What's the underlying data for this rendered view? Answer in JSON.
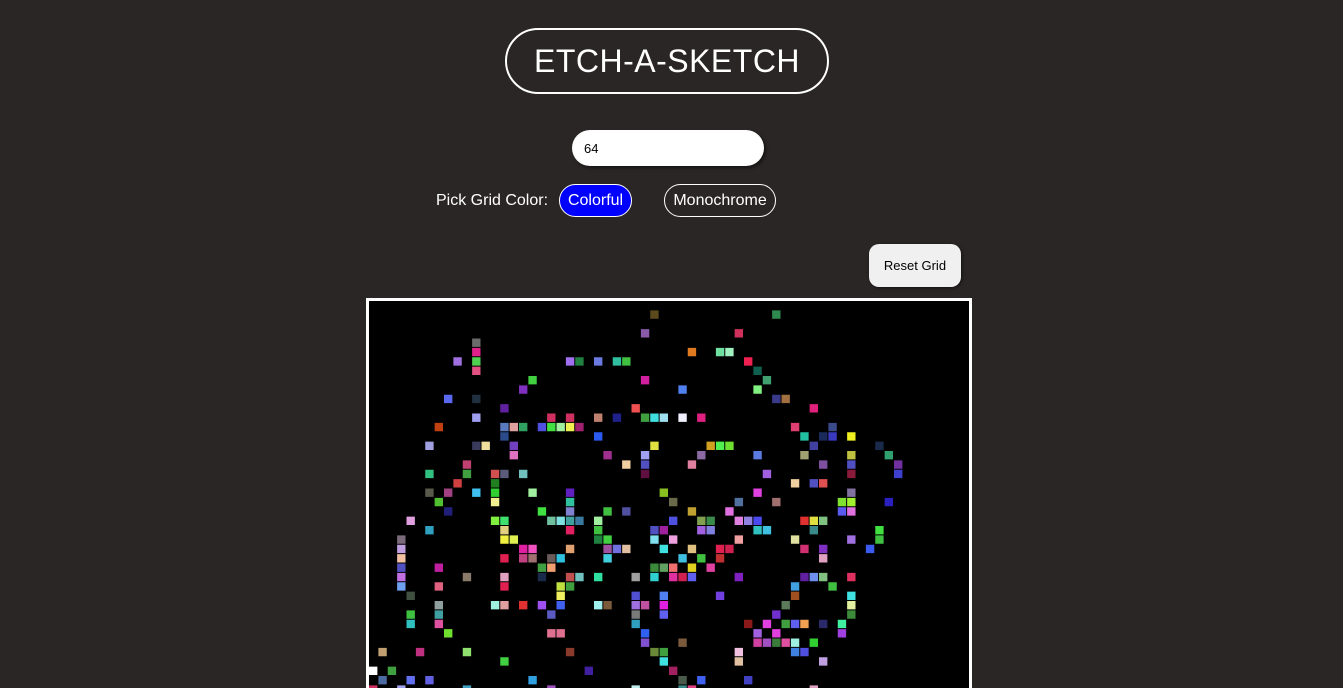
{
  "app": {
    "title": "ETCH-A-SKETCH"
  },
  "controls": {
    "grid_size_value": "64",
    "pick_color_label": "Pick Grid Color:",
    "colorful_label": "Colorful",
    "monochrome_label": "Monochrome",
    "reset_label": "Reset Grid",
    "selected_mode": "Colorful"
  },
  "colors": {
    "background": "#2b2626",
    "grid_background": "#000000",
    "active_button": "#0000ff",
    "frame": "#ffffff"
  },
  "grid": {
    "size": 64,
    "painted_cells": [
      [
        30,
        1,
        "#5b4a1c"
      ],
      [
        43,
        1,
        "#2f8a4f"
      ],
      [
        29,
        3,
        "#8a5aa8"
      ],
      [
        39,
        3,
        "#d0305a"
      ],
      [
        11,
        4,
        "#6a6a6a"
      ],
      [
        11,
        5,
        "#e0208a"
      ],
      [
        34,
        5,
        "#e07a20"
      ],
      [
        37,
        5,
        "#70e0a0"
      ],
      [
        38,
        5,
        "#a0f0c0"
      ],
      [
        9,
        6,
        "#a070e0"
      ],
      [
        11,
        6,
        "#50d050"
      ],
      [
        21,
        6,
        "#a070f0"
      ],
      [
        22,
        6,
        "#208040"
      ],
      [
        24,
        6,
        "#6a7ae0"
      ],
      [
        26,
        6,
        "#30c0a0"
      ],
      [
        27,
        6,
        "#40c040"
      ],
      [
        40,
        6,
        "#f02050"
      ],
      [
        11,
        7,
        "#e05080"
      ],
      [
        41,
        7,
        "#106050"
      ],
      [
        17,
        8,
        "#40d040"
      ],
      [
        29,
        8,
        "#d020a0"
      ],
      [
        42,
        8,
        "#40a070"
      ],
      [
        16,
        9,
        "#8030c0"
      ],
      [
        33,
        9,
        "#5080f0"
      ],
      [
        41,
        9,
        "#80f080"
      ],
      [
        8,
        10,
        "#5a6af0"
      ],
      [
        11,
        10,
        "#203040"
      ],
      [
        43,
        10,
        "#3a3a8a"
      ],
      [
        44,
        10,
        "#a07040"
      ],
      [
        14,
        11,
        "#6020a0"
      ],
      [
        28,
        11,
        "#f05050"
      ],
      [
        47,
        11,
        "#e0207a"
      ],
      [
        11,
        12,
        "#a0a0f0"
      ],
      [
        19,
        12,
        "#d03060"
      ],
      [
        21,
        12,
        "#d03060"
      ],
      [
        24,
        12,
        "#c08070"
      ],
      [
        26,
        12,
        "#20208a"
      ],
      [
        29,
        12,
        "#40a040"
      ],
      [
        30,
        12,
        "#40e0e0"
      ],
      [
        31,
        12,
        "#a0e0f0"
      ],
      [
        33,
        12,
        "#f0f0ff"
      ],
      [
        35,
        12,
        "#e02080"
      ],
      [
        7,
        13,
        "#c04010"
      ],
      [
        14,
        13,
        "#5a7ac0"
      ],
      [
        15,
        13,
        "#e0a0a0"
      ],
      [
        16,
        13,
        "#30a060"
      ],
      [
        18,
        13,
        "#5050e0"
      ],
      [
        19,
        13,
        "#40e040"
      ],
      [
        20,
        13,
        "#a0f0a0"
      ],
      [
        21,
        13,
        "#f0f050"
      ],
      [
        22,
        13,
        "#a02070"
      ],
      [
        45,
        13,
        "#e04070"
      ],
      [
        49,
        13,
        "#3a4a8a"
      ],
      [
        14,
        14,
        "#2a4a8a"
      ],
      [
        24,
        14,
        "#2a5af0"
      ],
      [
        46,
        14,
        "#20c0a0"
      ],
      [
        48,
        14,
        "#1a2a5a"
      ],
      [
        49,
        14,
        "#3a3ac0"
      ],
      [
        51,
        14,
        "#f0f020"
      ],
      [
        6,
        15,
        "#a0a0e0"
      ],
      [
        11,
        15,
        "#3a3a5a"
      ],
      [
        12,
        15,
        "#f0e0a0"
      ],
      [
        15,
        15,
        "#7040c0"
      ],
      [
        30,
        15,
        "#e0e040"
      ],
      [
        36,
        15,
        "#d0a020"
      ],
      [
        37,
        15,
        "#50f050"
      ],
      [
        38,
        15,
        "#70e030"
      ],
      [
        47,
        15,
        "#4040a0"
      ],
      [
        54,
        15,
        "#1a2a4a"
      ],
      [
        15,
        16,
        "#e070c0"
      ],
      [
        25,
        16,
        "#a03090"
      ],
      [
        29,
        16,
        "#a0a0f0"
      ],
      [
        35,
        16,
        "#8a6aa0"
      ],
      [
        41,
        16,
        "#5a7ae0"
      ],
      [
        46,
        16,
        "#a0a070"
      ],
      [
        51,
        16,
        "#c0c040"
      ],
      [
        55,
        16,
        "#30a070"
      ],
      [
        10,
        17,
        "#c04070"
      ],
      [
        27,
        17,
        "#f0d0a0"
      ],
      [
        29,
        17,
        "#5050c0"
      ],
      [
        34,
        17,
        "#e080a0"
      ],
      [
        48,
        17,
        "#8050a0"
      ],
      [
        51,
        17,
        "#5050c0"
      ],
      [
        56,
        17,
        "#7030a0"
      ],
      [
        6,
        18,
        "#30c080"
      ],
      [
        10,
        18,
        "#40a040"
      ],
      [
        13,
        18,
        "#d05050"
      ],
      [
        14,
        18,
        "#5a5a7a"
      ],
      [
        16,
        18,
        "#70c0c0"
      ],
      [
        29,
        18,
        "#601040"
      ],
      [
        42,
        18,
        "#a060e0"
      ],
      [
        51,
        18,
        "#8a1a3a"
      ],
      [
        56,
        18,
        "#4040d0"
      ],
      [
        9,
        19,
        "#d04040"
      ],
      [
        13,
        19,
        "#208020"
      ],
      [
        45,
        19,
        "#f0d0a0"
      ],
      [
        47,
        19,
        "#5050c0"
      ],
      [
        48,
        19,
        "#e05050"
      ],
      [
        6,
        20,
        "#5a5a4a"
      ],
      [
        8,
        20,
        "#a04080"
      ],
      [
        11,
        20,
        "#40c0f0"
      ],
      [
        13,
        20,
        "#30d030"
      ],
      [
        17,
        20,
        "#a0f0a0"
      ],
      [
        21,
        20,
        "#6020c0"
      ],
      [
        31,
        20,
        "#8ac020"
      ],
      [
        41,
        20,
        "#e040e0"
      ],
      [
        51,
        20,
        "#8070a0"
      ],
      [
        7,
        21,
        "#50c030"
      ],
      [
        13,
        21,
        "#f0f090"
      ],
      [
        21,
        21,
        "#30c0a0"
      ],
      [
        32,
        21,
        "#6a6a4a"
      ],
      [
        39,
        21,
        "#5070a0"
      ],
      [
        43,
        21,
        "#a07070"
      ],
      [
        50,
        21,
        "#80e030"
      ],
      [
        51,
        21,
        "#a0f030"
      ],
      [
        55,
        21,
        "#2a20c0"
      ],
      [
        8,
        22,
        "#20207a"
      ],
      [
        18,
        22,
        "#40e040"
      ],
      [
        21,
        22,
        "#8080d0"
      ],
      [
        25,
        22,
        "#40c040"
      ],
      [
        27,
        22,
        "#5050a0"
      ],
      [
        34,
        22,
        "#c0a030"
      ],
      [
        38,
        22,
        "#e070e0"
      ],
      [
        50,
        22,
        "#5a5af0"
      ],
      [
        51,
        22,
        "#e070e0"
      ],
      [
        4,
        23,
        "#e0a0e0"
      ],
      [
        13,
        23,
        "#80f040"
      ],
      [
        14,
        23,
        "#40e070"
      ],
      [
        19,
        23,
        "#70c0a0"
      ],
      [
        20,
        23,
        "#80e0e0"
      ],
      [
        21,
        23,
        "#40a0a0"
      ],
      [
        22,
        23,
        "#3a7aa0"
      ],
      [
        24,
        23,
        "#a0f0a0"
      ],
      [
        32,
        23,
        "#5050e0"
      ],
      [
        35,
        23,
        "#80a050"
      ],
      [
        36,
        23,
        "#3a8a4a"
      ],
      [
        39,
        23,
        "#e080e0"
      ],
      [
        40,
        23,
        "#9080e0"
      ],
      [
        41,
        23,
        "#4a4af0"
      ],
      [
        46,
        23,
        "#e03030"
      ],
      [
        47,
        23,
        "#e0e040"
      ],
      [
        48,
        23,
        "#80c080"
      ],
      [
        6,
        24,
        "#30a0c0"
      ],
      [
        14,
        24,
        "#e0d080"
      ],
      [
        21,
        24,
        "#e02060"
      ],
      [
        24,
        24,
        "#40c040"
      ],
      [
        30,
        24,
        "#5050c0"
      ],
      [
        31,
        24,
        "#a020a0"
      ],
      [
        35,
        24,
        "#a060e0"
      ],
      [
        36,
        24,
        "#8080e0"
      ],
      [
        41,
        24,
        "#30c0c0"
      ],
      [
        42,
        24,
        "#40c0e0"
      ],
      [
        47,
        24,
        "#3a8a8a"
      ],
      [
        54,
        24,
        "#40e040"
      ],
      [
        3,
        25,
        "#7a6a7a"
      ],
      [
        14,
        25,
        "#f0f040"
      ],
      [
        15,
        25,
        "#e0f050"
      ],
      [
        24,
        25,
        "#208040"
      ],
      [
        25,
        25,
        "#40d040"
      ],
      [
        30,
        25,
        "#80e0f0"
      ],
      [
        32,
        25,
        "#f0a0e0"
      ],
      [
        39,
        25,
        "#f0a0a0"
      ],
      [
        45,
        25,
        "#e0e0a0"
      ],
      [
        51,
        25,
        "#a070e0"
      ],
      [
        54,
        25,
        "#40c040"
      ],
      [
        3,
        26,
        "#c0a0e0"
      ],
      [
        16,
        26,
        "#e020a0"
      ],
      [
        17,
        26,
        "#f050c0"
      ],
      [
        21,
        26,
        "#e0a070"
      ],
      [
        25,
        26,
        "#a050a0"
      ],
      [
        26,
        26,
        "#7070e0"
      ],
      [
        27,
        26,
        "#e0c0a0"
      ],
      [
        31,
        26,
        "#40e0e0"
      ],
      [
        34,
        26,
        "#e0c080"
      ],
      [
        37,
        26,
        "#e02050"
      ],
      [
        38,
        26,
        "#d02050"
      ],
      [
        46,
        26,
        "#d03070"
      ],
      [
        48,
        26,
        "#8030c0"
      ],
      [
        53,
        26,
        "#3a5af0"
      ],
      [
        3,
        27,
        "#f0c0a0"
      ],
      [
        14,
        27,
        "#e02050"
      ],
      [
        16,
        27,
        "#c04080"
      ],
      [
        17,
        27,
        "#a07070"
      ],
      [
        19,
        27,
        "#6a5a5a"
      ],
      [
        20,
        27,
        "#30c0e0"
      ],
      [
        25,
        27,
        "#40d0e0"
      ],
      [
        33,
        27,
        "#40c0e0"
      ],
      [
        35,
        27,
        "#40c040"
      ],
      [
        37,
        27,
        "#c03030"
      ],
      [
        48,
        27,
        "#e0a0c0"
      ],
      [
        3,
        28,
        "#5050c0"
      ],
      [
        7,
        28,
        "#c020a0"
      ],
      [
        18,
        28,
        "#40a040"
      ],
      [
        19,
        28,
        "#f0a070"
      ],
      [
        30,
        28,
        "#3a8a3a"
      ],
      [
        31,
        28,
        "#60a060"
      ],
      [
        32,
        28,
        "#f07070"
      ],
      [
        34,
        28,
        "#e0d020"
      ],
      [
        36,
        28,
        "#e040a0"
      ],
      [
        3,
        29,
        "#c070e0"
      ],
      [
        10,
        29,
        "#8a7a6a"
      ],
      [
        14,
        29,
        "#e0a0c0"
      ],
      [
        18,
        29,
        "#1a2a4a"
      ],
      [
        21,
        29,
        "#c05050"
      ],
      [
        22,
        29,
        "#70c0c0"
      ],
      [
        24,
        29,
        "#30e0a0"
      ],
      [
        28,
        29,
        "#a0a0a0"
      ],
      [
        30,
        29,
        "#30d0d0"
      ],
      [
        32,
        29,
        "#e030a0"
      ],
      [
        33,
        29,
        "#d02050"
      ],
      [
        34,
        29,
        "#6060f0"
      ],
      [
        39,
        29,
        "#8020c0"
      ],
      [
        46,
        29,
        "#6020a0"
      ],
      [
        47,
        29,
        "#7090f0"
      ],
      [
        48,
        29,
        "#80c080"
      ],
      [
        51,
        29,
        "#e03060"
      ],
      [
        3,
        30,
        "#70a0f0"
      ],
      [
        7,
        30,
        "#e06080"
      ],
      [
        14,
        30,
        "#e02050"
      ],
      [
        20,
        30,
        "#c0e040"
      ],
      [
        21,
        30,
        "#40a040"
      ],
      [
        45,
        30,
        "#40a0e0"
      ],
      [
        49,
        30,
        "#40c040"
      ],
      [
        4,
        31,
        "#405040"
      ],
      [
        20,
        31,
        "#f0f060"
      ],
      [
        28,
        31,
        "#5050d0"
      ],
      [
        31,
        31,
        "#5080f0"
      ],
      [
        37,
        31,
        "#7040e0"
      ],
      [
        45,
        31,
        "#a05020"
      ],
      [
        51,
        31,
        "#40e0e0"
      ],
      [
        7,
        32,
        "#90a0a0"
      ],
      [
        13,
        32,
        "#a0f0e0"
      ],
      [
        14,
        32,
        "#e0a0a0"
      ],
      [
        16,
        32,
        "#e03030"
      ],
      [
        18,
        32,
        "#a050f0"
      ],
      [
        20,
        32,
        "#4060f0"
      ],
      [
        24,
        32,
        "#a0f0f0"
      ],
      [
        25,
        32,
        "#7a5a3a"
      ],
      [
        28,
        32,
        "#a070e0"
      ],
      [
        29,
        32,
        "#c050a0"
      ],
      [
        31,
        32,
        "#e020e0"
      ],
      [
        44,
        32,
        "#5a7a5a"
      ],
      [
        51,
        32,
        "#e0f0a0"
      ],
      [
        4,
        33,
        "#40c040"
      ],
      [
        7,
        33,
        "#40a0a0"
      ],
      [
        19,
        33,
        "#5a5ac0"
      ],
      [
        28,
        33,
        "#7a7a7a"
      ],
      [
        31,
        33,
        "#6060f0"
      ],
      [
        43,
        33,
        "#7030d0"
      ],
      [
        51,
        33,
        "#3a8a3a"
      ],
      [
        4,
        34,
        "#30c0c0"
      ],
      [
        7,
        34,
        "#e050a0"
      ],
      [
        28,
        34,
        "#30a0c0"
      ],
      [
        40,
        34,
        "#8a1a1a"
      ],
      [
        42,
        34,
        "#e040e0"
      ],
      [
        44,
        34,
        "#40a040"
      ],
      [
        45,
        34,
        "#6060f0"
      ],
      [
        46,
        34,
        "#f0a050"
      ],
      [
        48,
        34,
        "#2a2a6a"
      ],
      [
        50,
        34,
        "#40f0a0"
      ],
      [
        8,
        35,
        "#70e030"
      ],
      [
        19,
        35,
        "#e07090"
      ],
      [
        20,
        35,
        "#e07090"
      ],
      [
        29,
        35,
        "#3060f0"
      ],
      [
        41,
        35,
        "#a060e0"
      ],
      [
        43,
        35,
        "#e040e0"
      ],
      [
        50,
        35,
        "#a040e0"
      ],
      [
        29,
        36,
        "#8050d0"
      ],
      [
        33,
        36,
        "#7a5a3a"
      ],
      [
        41,
        36,
        "#d040a0"
      ],
      [
        42,
        36,
        "#a050c0"
      ],
      [
        43,
        36,
        "#3a7a3a"
      ],
      [
        44,
        36,
        "#e050a0"
      ],
      [
        45,
        36,
        "#a0f0e0"
      ],
      [
        47,
        36,
        "#30d030"
      ],
      [
        1,
        37,
        "#c0a070"
      ],
      [
        5,
        37,
        "#c03080"
      ],
      [
        10,
        37,
        "#90e070"
      ],
      [
        21,
        37,
        "#8a3a2a"
      ],
      [
        30,
        37,
        "#6a8a3a"
      ],
      [
        31,
        37,
        "#40a040"
      ],
      [
        39,
        37,
        "#f0c0e0"
      ],
      [
        45,
        37,
        "#4080e0"
      ],
      [
        46,
        37,
        "#5050e0"
      ],
      [
        14,
        38,
        "#40d040"
      ],
      [
        31,
        38,
        "#40e0e0"
      ],
      [
        39,
        38,
        "#e0c0a0"
      ],
      [
        48,
        38,
        "#c0a0e0"
      ],
      [
        0,
        39,
        "#ffffff"
      ],
      [
        2,
        39,
        "#40a040"
      ],
      [
        23,
        39,
        "#4020a0"
      ],
      [
        32,
        39,
        "#a02060"
      ],
      [
        1,
        40,
        "#4a6aa0"
      ],
      [
        4,
        40,
        "#6070f0"
      ],
      [
        6,
        40,
        "#6060e0"
      ],
      [
        17,
        40,
        "#30a0e0"
      ],
      [
        33,
        40,
        "#4a5a4a"
      ],
      [
        35,
        40,
        "#4060f0"
      ],
      [
        40,
        40,
        "#4040c0"
      ],
      [
        0,
        41,
        "#d03060"
      ],
      [
        3,
        41,
        "#a0a0f0"
      ],
      [
        10,
        41,
        "#40a0c0"
      ],
      [
        19,
        41,
        "#a050c0"
      ],
      [
        28,
        41,
        "#c0f0f0"
      ],
      [
        33,
        41,
        "#3a8a8a"
      ],
      [
        34,
        41,
        "#e04080"
      ],
      [
        47,
        41,
        "#e0a0c0"
      ]
    ]
  }
}
